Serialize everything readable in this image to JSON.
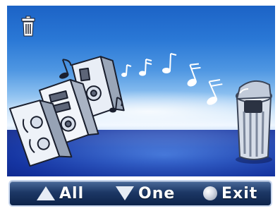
{
  "screen": {
    "top_icon": "trash-can-icon",
    "illustration": [
      "speaker-stack-icon",
      "music-notes-icon",
      "waste-bin-icon"
    ]
  },
  "controls": {
    "all": {
      "icon": "triangle-up-icon",
      "label": "All"
    },
    "one": {
      "icon": "triangle-down-icon",
      "label": "One"
    },
    "exit": {
      "icon": "round-button-icon",
      "label": "Exit"
    }
  },
  "colors": {
    "sky": "#2a78d6",
    "bar": "#1d3866",
    "bar_border": "#c9d7ee",
    "label": "#ffffff"
  }
}
